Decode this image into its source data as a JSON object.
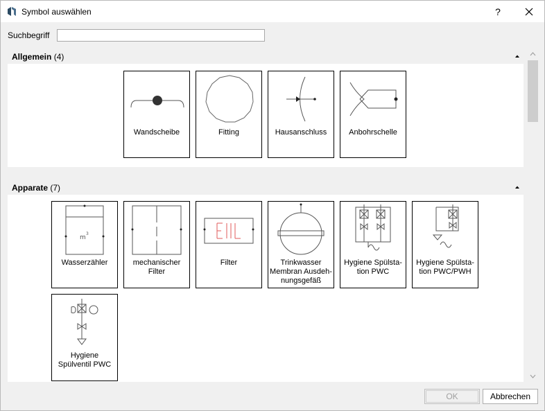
{
  "window": {
    "title": "Symbol auswählen",
    "help_label": "?"
  },
  "search": {
    "label": "Suchbegriff",
    "value": "",
    "placeholder": ""
  },
  "groups": [
    {
      "name": "Allgemein",
      "count": "(4)",
      "items": [
        {
          "label": "Wandscheibe",
          "icon": "wall-disc-symbol"
        },
        {
          "label": "Fitting",
          "icon": "fitting-symbol"
        },
        {
          "label": "Hausanschluss",
          "icon": "house-connection-symbol"
        },
        {
          "label": "Anbohrschelle",
          "icon": "tapping-clamp-symbol"
        }
      ]
    },
    {
      "name": "Apparate",
      "count": "(7)",
      "items": [
        {
          "label": "Wasserzähler",
          "icon": "water-meter-symbol"
        },
        {
          "label": "mechanischer Filter",
          "icon": "mechanical-filter-symbol"
        },
        {
          "label": "Filter",
          "icon": "filter-symbol"
        },
        {
          "label": "Trinkwasser Mem­bran Ausdeh­nungsgefäß",
          "icon": "expansion-vessel-symbol"
        },
        {
          "label": "Hygiene Spülsta­tion PWC",
          "icon": "hygiene-flush-station-pwc-symbol"
        },
        {
          "label": "Hygiene Spülsta­tion PWC/PWH",
          "icon": "hygiene-flush-station-pwc-pwh-symbol"
        },
        {
          "label": "Hygiene Spülventil PWC",
          "icon": "hygiene-flush-valve-pwc-symbol"
        }
      ]
    }
  ],
  "buttons": {
    "ok": "OK",
    "cancel": "Abbrechen"
  },
  "colors": {
    "filter_accent": "#e05a5a",
    "window_bg": "#f0f0f0"
  }
}
